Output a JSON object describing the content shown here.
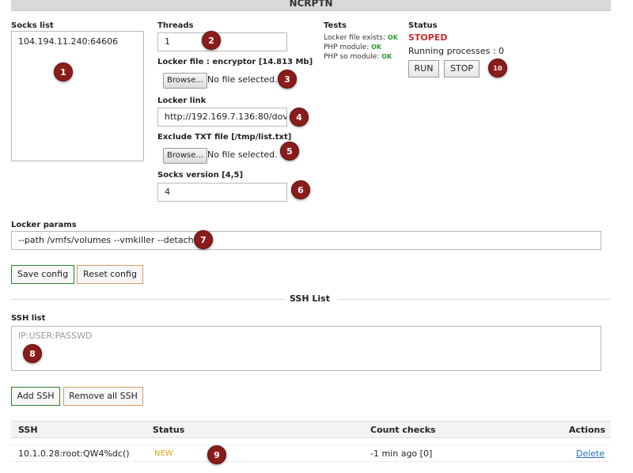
{
  "header": {
    "title": "NCRPTN"
  },
  "socks": {
    "label": "Socks list",
    "items": [
      "104.194.11.240:64606"
    ]
  },
  "threads": {
    "label": "Threads",
    "value": "1"
  },
  "locker_file": {
    "label": "Locker file : encryptor [14.813 Mb]",
    "browse_label": "Browse...",
    "file_text": "No file selected."
  },
  "locker_link": {
    "label": "Locker link",
    "value": "http://192.169.7.136:80/dov"
  },
  "exclude_file": {
    "label": "Exclude TXT file [/tmp/list.txt]",
    "browse_label": "Browse...",
    "file_text": "No file selected."
  },
  "socks_version": {
    "label": "Socks version [4,5]",
    "value": "4"
  },
  "tests": {
    "label": "Tests",
    "items": [
      {
        "name": "Locker file exists:",
        "result": "OK"
      },
      {
        "name": "PHP module:",
        "result": "OK"
      },
      {
        "name": "PHP so module:",
        "result": "OK"
      }
    ]
  },
  "status": {
    "label": "Status",
    "value": "STOPED",
    "running_text": "Running processes : 0",
    "run_label": "RUN",
    "stop_label": "STOP"
  },
  "locker_params": {
    "label": "Locker params",
    "value": "--path /vmfs/volumes --vmkiller --detach"
  },
  "config_buttons": {
    "save_label": "Save config",
    "reset_label": "Reset config"
  },
  "ssh_section": {
    "title": "SSH List"
  },
  "ssh_list": {
    "label": "SSH list",
    "placeholder": "IP:USER:PASSWD"
  },
  "ssh_buttons": {
    "add_label": "Add SSH",
    "remove_label": "Remove all SSH"
  },
  "ssh_table": {
    "headers": {
      "ssh": "SSH",
      "status": "Status",
      "count": "Count checks",
      "actions": "Actions"
    },
    "rows": [
      {
        "ssh": "10.1.0.28:root:QW4%dc()",
        "status": "NEW",
        "count": "-1 min ago [0]",
        "action": "Delete"
      }
    ]
  },
  "markers": [
    "1",
    "2",
    "3",
    "4",
    "5",
    "6",
    "7",
    "8",
    "9",
    "10"
  ],
  "colors": {
    "status_stopped": "#d12a2a",
    "ok": "#2c9b2c",
    "new": "#d8a21c",
    "marker": "#8b1c1c",
    "link": "#2a6bc4"
  }
}
